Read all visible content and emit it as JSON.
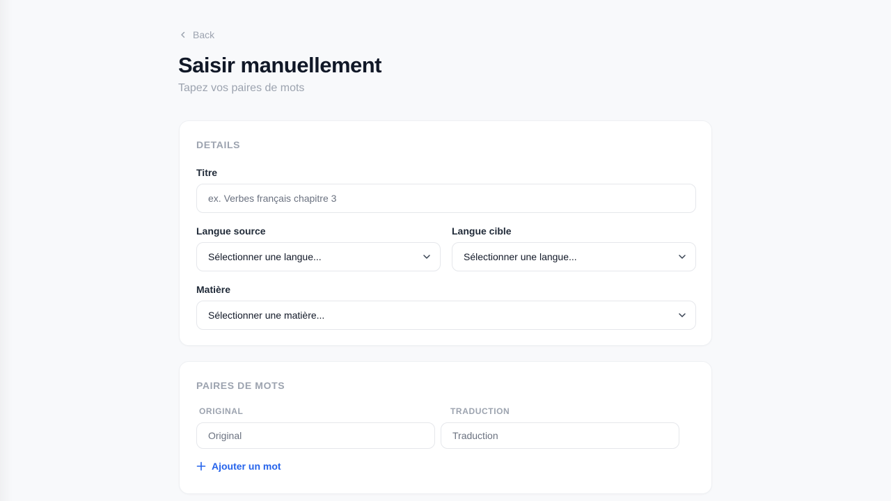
{
  "nav": {
    "back_label": "Back"
  },
  "header": {
    "title": "Saisir manuellement",
    "subtitle": "Tapez vos paires de mots"
  },
  "details": {
    "section_title": "DETAILS",
    "title_label": "Titre",
    "title_placeholder": "ex. Verbes français chapitre 3",
    "source_label": "Langue source",
    "source_value": "Sélectionner une langue...",
    "target_label": "Langue cible",
    "target_value": "Sélectionner une langue...",
    "subject_label": "Matière",
    "subject_value": "Sélectionner une matière..."
  },
  "pairs": {
    "section_title": "PAIRES DE MOTS",
    "original_header": "ORIGINAL",
    "translation_header": "TRADUCTION",
    "rows": [
      {
        "original_placeholder": "Original",
        "translation_placeholder": "Traduction"
      }
    ],
    "add_label": "Ajouter un mot"
  },
  "colors": {
    "accent": "#2563eb",
    "background": "#f8f9fb",
    "card": "#ffffff",
    "muted_text": "#9ca3af"
  },
  "icons": {
    "back": "chevron-left-icon",
    "select": "chevron-down-icon",
    "add": "plus-icon"
  }
}
